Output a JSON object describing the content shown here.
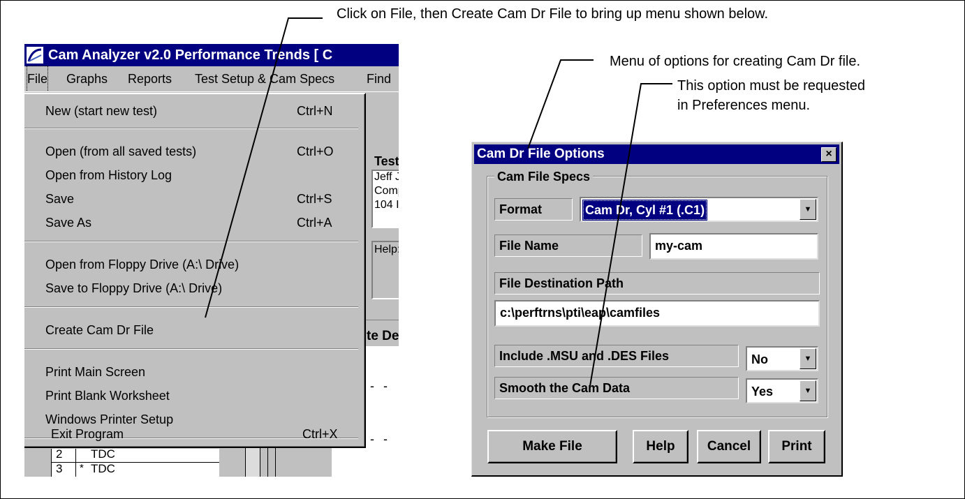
{
  "callouts": {
    "top": "Click on File, then Create Cam Dr File to bring up menu shown below.",
    "menu_options": "Menu of options for creating Cam Dr file.",
    "prefs_line1": "This option must be requested",
    "prefs_line2": "in Preferences menu."
  },
  "app": {
    "title": "Cam Analyzer v2.0   Performance Trends   [ C",
    "menubar": [
      "File",
      "Graphs",
      "Reports",
      "Test Setup & Cam Specs",
      "Find"
    ],
    "background": {
      "test_label": "Test",
      "lines": [
        "Jeff J",
        "Comp",
        "104 I"
      ],
      "help_label": "Help:",
      "column_fragment": "te De",
      "rows": [
        {
          "num": "2",
          "mark": "",
          "val": "TDC"
        },
        {
          "num": "3",
          "mark": "*",
          "val": "TDC"
        }
      ]
    },
    "file_menu": {
      "items": [
        {
          "label": "New (start new test)",
          "shortcut": "Ctrl+N"
        },
        {
          "label": "Open (from all saved tests)",
          "shortcut": "Ctrl+O"
        },
        {
          "label": "Open from History Log",
          "shortcut": ""
        },
        {
          "label": "Save",
          "shortcut": "Ctrl+S"
        },
        {
          "label": "Save As",
          "shortcut": "Ctrl+A"
        },
        {
          "label": "Open from Floppy Drive   (A:\\ Drive)",
          "shortcut": ""
        },
        {
          "label": "Save to Floppy Drive   (A:\\ Drive)",
          "shortcut": ""
        },
        {
          "label": "Create Cam Dr File",
          "shortcut": ""
        },
        {
          "label": "Print Main Screen",
          "shortcut": ""
        },
        {
          "label": "Print Blank Worksheet",
          "shortcut": ""
        },
        {
          "label": "Windows Printer Setup",
          "shortcut": ""
        },
        {
          "label": "Exit Program",
          "shortcut": "Ctrl+X"
        }
      ]
    }
  },
  "dialog": {
    "title": "Cam Dr File Options",
    "close": "×",
    "group_title": "Cam File Specs",
    "format_label": "Format",
    "format_value": "Cam Dr, Cyl #1 (.C1)",
    "file_name_label": "File Name",
    "file_name_value": "my-cam",
    "dest_label": "File Destination Path",
    "dest_value": "c:\\perftrns\\pti\\eap\\camfiles",
    "include_label": "Include .MSU and .DES Files",
    "include_value": "No",
    "smooth_label": "Smooth the Cam Data",
    "smooth_value": "Yes",
    "buttons": [
      "Make File",
      "Help",
      "Cancel",
      "Print"
    ],
    "arrow_glyph": "▼"
  },
  "colors": {
    "titlebar": "#000080",
    "face": "#c0c0c0",
    "selection": "#000080"
  }
}
